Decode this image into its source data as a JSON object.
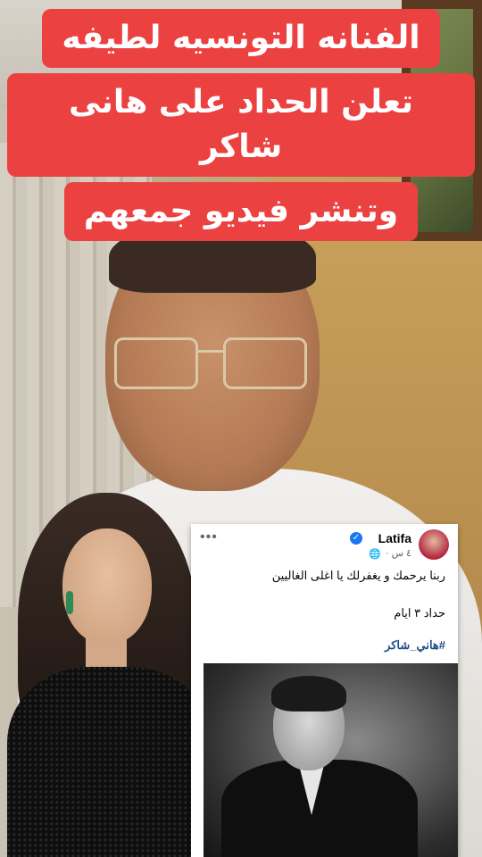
{
  "headline": {
    "lines": [
      "الفنانه التونسيه لطيفه",
      "تعلن الحداد على هانى شاكر",
      "وتنشر فيديو جمعهم"
    ],
    "background_color": "#ec4141",
    "text_color": "#ffffff"
  },
  "post": {
    "author": "Latifa",
    "verified": true,
    "time": "٤ س ·",
    "privacy_icon": "globe-icon",
    "more_icon": "more-dots-icon",
    "text_line_1": "ربنا يرحمك و يغفرلك يا اغلى الغاليين",
    "text_line_2": "حداد ٣ ايام",
    "hashtag": "#هاني_شاكر"
  }
}
